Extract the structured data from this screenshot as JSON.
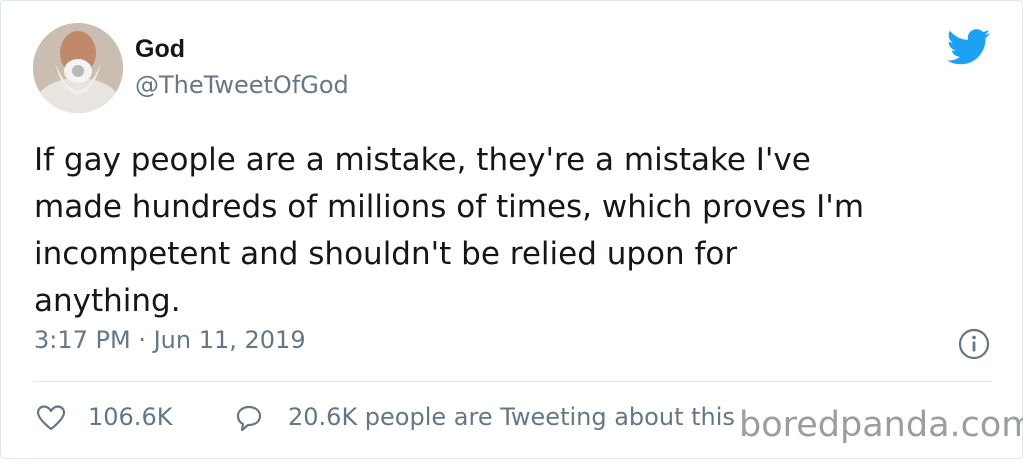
{
  "tweet": {
    "author_name": "God",
    "handle": "@TheTweetOfGod",
    "text": "If gay people are a mistake, they're a mistake I've\nmade hundreds of millions of times, which proves I'm\nincompetent and shouldn't be relied upon for\nanything.",
    "timestamp": "3:17 PM · Jun 11, 2019",
    "likes": "106.6K",
    "tweeting_about": "20.6K people are Tweeting about this"
  },
  "icons": {
    "logo": "twitter-bird-icon",
    "info": "info-icon",
    "like": "heart-icon",
    "reply": "speech-bubble-icon"
  },
  "watermark": "boredpanda.com",
  "colors": {
    "twitter_blue": "#1da1f2",
    "secondary_text": "#657786",
    "primary_text": "#14171a"
  }
}
